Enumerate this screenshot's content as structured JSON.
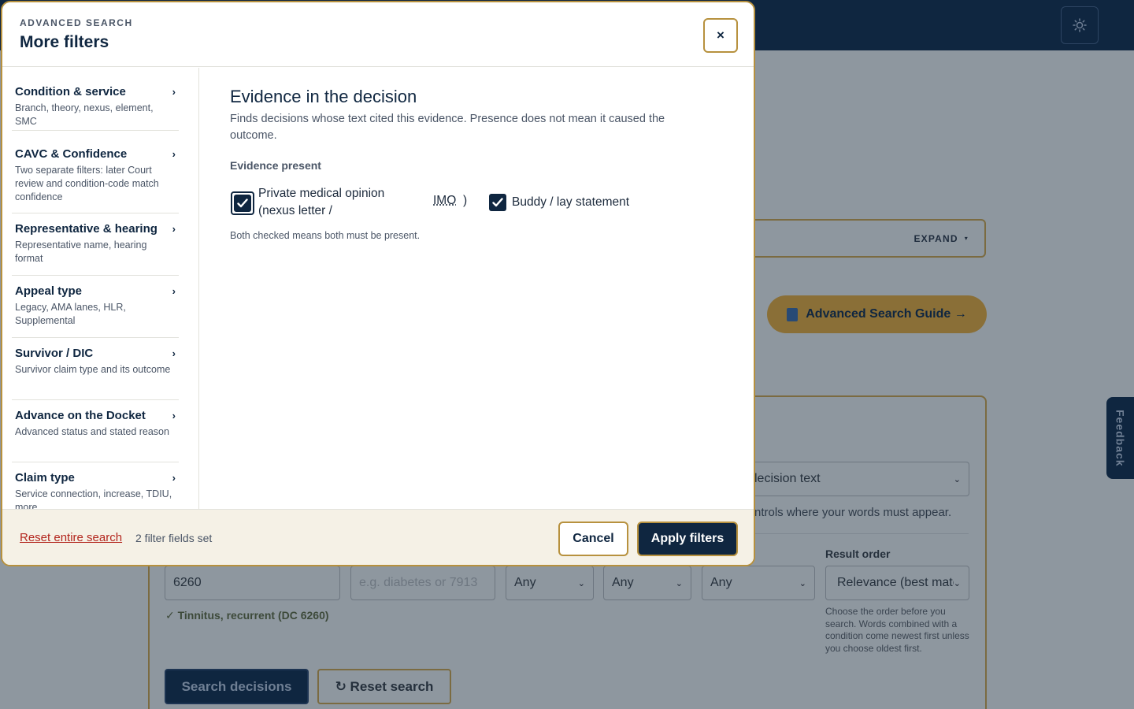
{
  "background": {
    "expand_label": "EXPAND",
    "guide_label": "Advanced Search Guide →",
    "feedback_label": "Feedback",
    "search_in_value": "lecision text",
    "search_in_help": "ntrols where your words must appear.",
    "result_order_label": "Result order",
    "result_order_value": "Relevance (best matc",
    "result_order_help": "Choose the order before you search. Words combined with a condition come newest first unless you choose oldest first.",
    "dc_value": "6260",
    "dc_match": "✓ Tinnitus, recurrent (DC 6260)",
    "condition_placeholder": "e.g. diabetes or 7913",
    "any_1": "Any",
    "any_2": "Any",
    "any_3": "Any",
    "search_button": "Search decisions",
    "reset_button": "↻ Reset search"
  },
  "modal": {
    "eyebrow": "ADVANCED SEARCH",
    "title": "More filters",
    "close_label": "×",
    "sidebar": [
      {
        "title": "Condition & service",
        "desc": "Branch, theory, nexus, element, SMC"
      },
      {
        "title": "CAVC & Confidence",
        "desc": "Two separate filters: later Court review and condition-code match confidence"
      },
      {
        "title": "Representative & hearing",
        "desc": "Representative name, hearing format"
      },
      {
        "title": "Appeal type",
        "desc": "Legacy, AMA lanes, HLR, Supplemental"
      },
      {
        "title": "Survivor / DIC",
        "desc": "Survivor claim type and its outcome"
      },
      {
        "title": "Advance on the Docket",
        "desc": "Advanced status and stated reason"
      },
      {
        "title": "Claim type",
        "desc": "Service connection, increase, TDIU, more"
      }
    ],
    "content": {
      "title": "Evidence in the decision",
      "desc": "Finds decisions whose text cited this evidence. Presence does not mean it caused the outcome.",
      "group_label": "Evidence present",
      "option_1_line1": "Private medical opinion",
      "option_1_line2": "(nexus letter /",
      "option_1_abbr": "IMO",
      "option_1_close": ")",
      "option_2": "Buddy / lay statement",
      "hint": "Both checked means both must be present."
    },
    "footer": {
      "reset": "Reset entire search",
      "count": "2 filter fields set",
      "cancel": "Cancel",
      "apply": "Apply filters"
    }
  }
}
